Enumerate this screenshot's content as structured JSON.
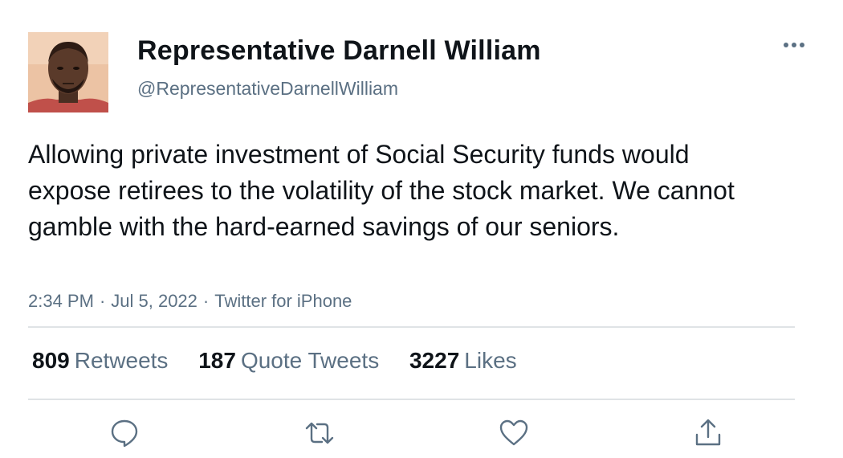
{
  "author": {
    "display_name": "Representative Darnell William",
    "handle": "@RepresentativeDarnellWilliam",
    "avatar_icon": "user-avatar-photo"
  },
  "tweet": {
    "text": "Allowing private investment of Social Security funds would expose retirees to the volatility of the stock market. We cannot gamble with the hard-earned savings of our seniors.",
    "time": "2:34 PM",
    "date": "Jul 5, 2022",
    "source": "Twitter for iPhone",
    "separator": "·"
  },
  "stats": {
    "retweets": {
      "count": "809",
      "label": "Retweets"
    },
    "quote_tweets": {
      "count": "187",
      "label": "Quote Tweets"
    },
    "likes": {
      "count": "3227",
      "label": "Likes"
    }
  },
  "actions": [
    "reply-icon",
    "retweet-icon",
    "like-icon",
    "share-icon"
  ],
  "colors": {
    "text": "#0f1419",
    "secondary": "#5b7083",
    "divider": "#dfe3e6",
    "icon": "#5b7083"
  }
}
